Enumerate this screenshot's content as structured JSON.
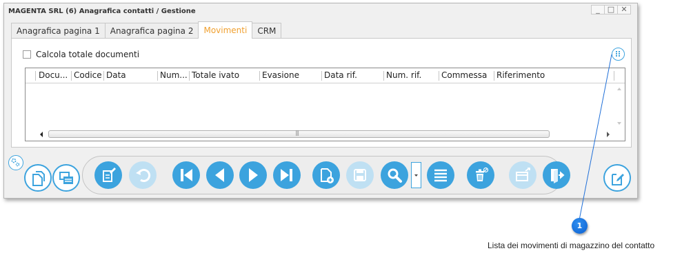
{
  "window": {
    "title": "MAGENTA SRL (6) Anagrafica contatti / Gestione",
    "controls": [
      "_",
      "□",
      "✕"
    ]
  },
  "tabs": [
    {
      "label": "Anagrafica pagina 1",
      "active": false
    },
    {
      "label": "Anagrafica pagina 2",
      "active": false
    },
    {
      "label": "Movimenti",
      "active": true
    },
    {
      "label": "CRM",
      "active": false
    }
  ],
  "movimenti": {
    "checkbox_label": "Calcola totale documenti",
    "checkbox_checked": false,
    "columns": [
      "Docu...",
      "Codice",
      "Data",
      "Num...",
      "Totale ivato",
      "Evasione",
      "Data rif.",
      "Num. rif.",
      "Commessa",
      "Riferimento"
    ],
    "rows": [],
    "scroll_grip": "|||"
  },
  "toolbar": {
    "left_buttons": [
      "settings-icon",
      "copy-record-icon",
      "duplicate-record-icon"
    ],
    "center_buttons": [
      "edit-icon",
      "undo-icon",
      "first-record-icon",
      "previous-record-icon",
      "next-record-icon",
      "last-record-icon",
      "new-record-icon",
      "save-icon",
      "search-icon",
      "search-dropdown-icon",
      "list-icon",
      "delete-icon",
      "print-icon",
      "exit-icon"
    ],
    "right_buttons": [
      "notes-icon"
    ],
    "disabled": [
      "undo-icon",
      "save-icon",
      "print-icon"
    ]
  },
  "callout": {
    "number": "1",
    "text": "Lista dei movimenti di magazzino del contatto"
  },
  "colors": {
    "accent": "#3ca3de",
    "accent_disabled": "#bfe0f3",
    "active_tab_text": "#f0a030",
    "badge": "#0b5fd0"
  }
}
